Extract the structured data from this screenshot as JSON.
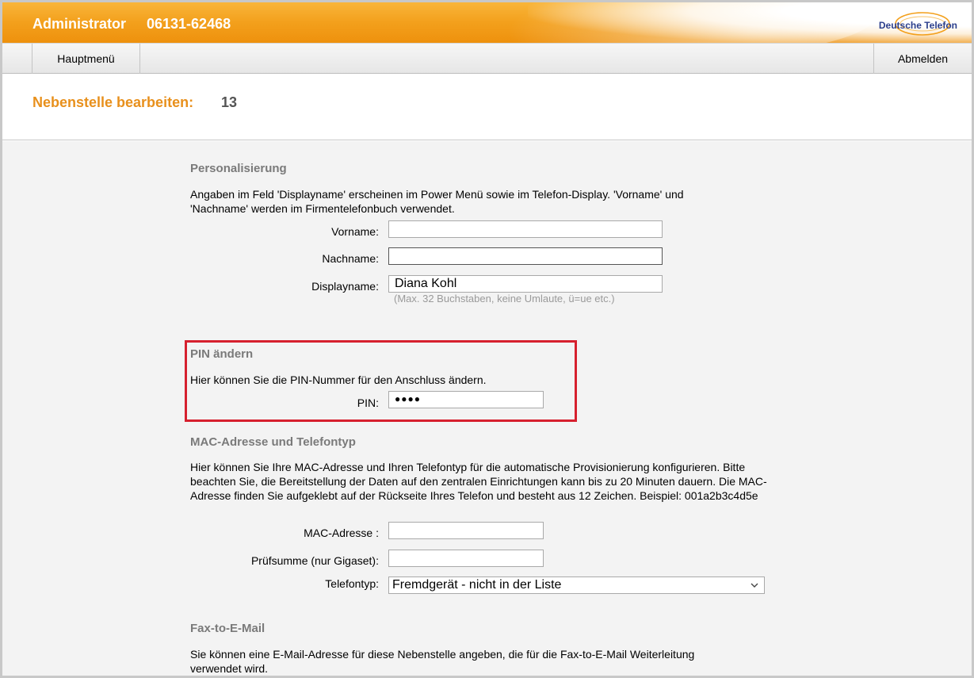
{
  "header": {
    "role": "Administrator",
    "phone": "06131-62468",
    "logo_text": "Deutsche Telefon"
  },
  "nav": {
    "home_label": "Hauptmenü",
    "logout_label": "Abmelden"
  },
  "page": {
    "title": "Nebenstelle bearbeiten:",
    "extension": "13"
  },
  "personalisierung": {
    "heading": "Personalisierung",
    "description": "Angaben im Feld 'Displayname' erscheinen im Power Menü sowie im Telefon-Display. 'Vorname' und 'Nachname' werden im Firmentelefonbuch verwendet.",
    "vorname_label": "Vorname:",
    "vorname_value": "",
    "nachname_label": "Nachname:",
    "nachname_value": "",
    "displayname_label": "Displayname:",
    "displayname_value": "Diana Kohl",
    "displayname_hint": "(Max. 32 Buchstaben, keine Umlaute, ü=ue etc.)"
  },
  "pin": {
    "heading": "PIN ändern",
    "description": "Hier können Sie die PIN-Nummer für den Anschluss ändern.",
    "label": "PIN:",
    "masked_value": "●●●●"
  },
  "mac": {
    "heading": "MAC-Adresse und Telefontyp",
    "description": "Hier können Sie Ihre MAC-Adresse und Ihren Telefontyp für die automatische Provisionierung konfigurieren. Bitte beachten Sie, die Bereitstellung der Daten auf den zentralen Einrichtungen kann bis zu 20 Minuten dauern. Die MAC-Adresse finden Sie aufgeklebt auf der Rückseite Ihres Telefon und besteht aus 12 Zeichen. Beispiel: 001a2b3c4d5e",
    "mac_label": "MAC-Adresse :",
    "mac_value": "",
    "checksum_label": "Prüfsumme (nur Gigaset):",
    "checksum_value": "",
    "type_label": "Telefontyp:",
    "type_selected": "Fremdgerät - nicht in der Liste"
  },
  "fax": {
    "heading": "Fax-to-E-Mail",
    "description": "Sie können eine E-Mail-Adresse für diese Nebenstelle angeben, die für die Fax-to-E-Mail Weiterleitung verwendet wird."
  },
  "colors": {
    "brand_orange": "#f3a01c",
    "title_orange": "#e8901c",
    "highlight_red": "#d6202e"
  }
}
